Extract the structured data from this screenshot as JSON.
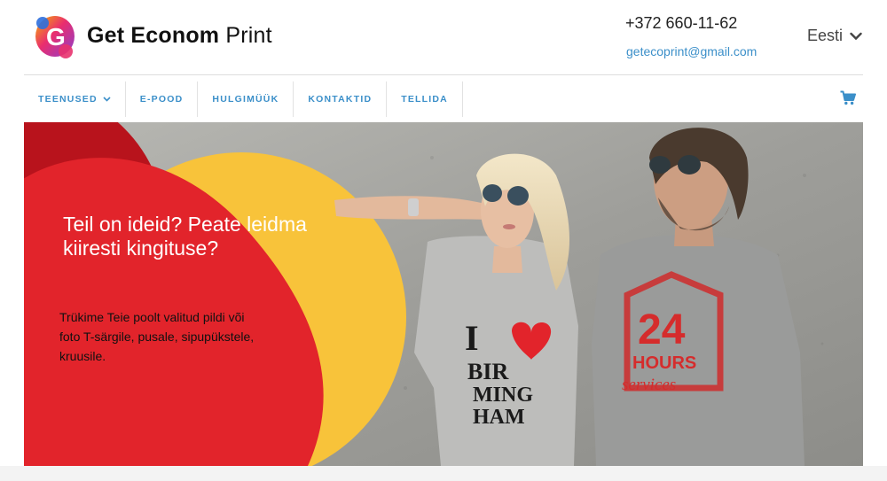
{
  "brand": {
    "name_bold": "Get Econom",
    "name_light": " Print",
    "logo_letter": "G"
  },
  "contact": {
    "phone": "+372 660-11-62",
    "email": "getecoprint@gmail.com"
  },
  "language": {
    "selected": "Eesti"
  },
  "nav": {
    "items": [
      {
        "label": "TEENUSED",
        "has_dropdown": true
      },
      {
        "label": "E-POOD"
      },
      {
        "label": "HULGIMÜÜK"
      },
      {
        "label": "KONTAKTID"
      },
      {
        "label": "TELLIDA"
      }
    ],
    "cart_icon": "shopping-cart-icon"
  },
  "hero": {
    "title": "Teil on ideid? Peate leidma kiiresti kingituse?",
    "text": "Trükime Teie poolt valitud pildi või foto T-särgile, pusale, sipupükstele, kruusile.",
    "shirt_left": {
      "text_1": "I",
      "text_2": "BIR",
      "text_3": "MING",
      "text_4": "HAM"
    },
    "shirt_right": {
      "number": "24",
      "line_1": "HOURS",
      "line_2": "services"
    }
  },
  "colors": {
    "accent_blue": "#3b8fc9",
    "hero_red": "#e2242b",
    "hero_yellow": "#f8c33a",
    "hero_dark_red": "#b8131c"
  }
}
